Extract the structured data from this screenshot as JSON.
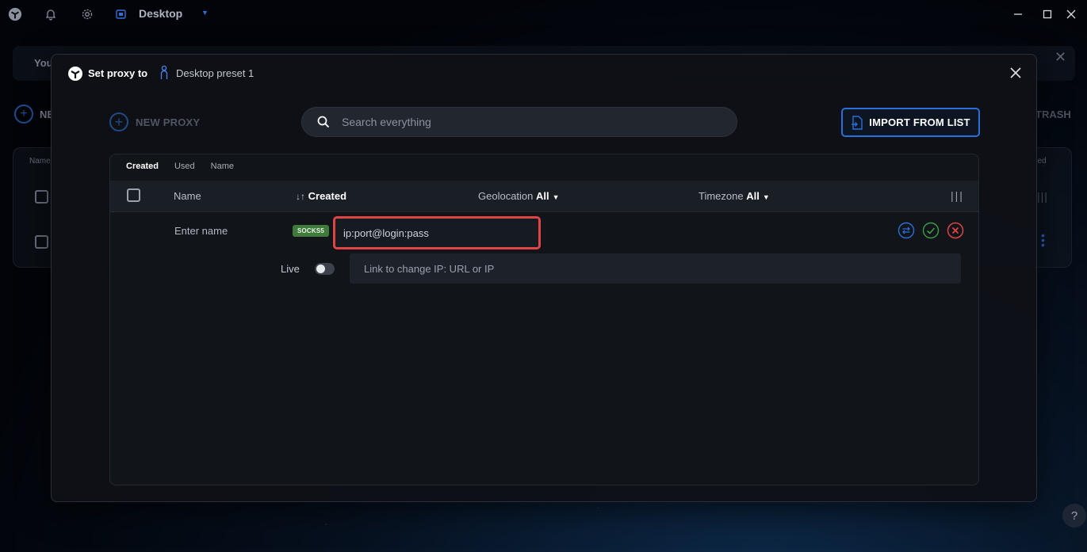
{
  "app": {
    "title": "Desktop"
  },
  "background": {
    "banner_text": "You",
    "new_text": "NE",
    "trash_text": "TRASH",
    "col_name": "Name",
    "col_right": "ned"
  },
  "modal": {
    "title": "Set proxy to",
    "preset": "Desktop preset 1",
    "new_proxy_label": "NEW PROXY",
    "search_placeholder": "Search everything",
    "import_label": "IMPORT FROM LIST",
    "sort_tabs": [
      "Created",
      "Used",
      "Name"
    ],
    "table": {
      "headers": {
        "name": "Name",
        "created": "Created",
        "geolocation": "Geolocation",
        "geolocation_value": "All",
        "timezone": "Timezone",
        "timezone_value": "All"
      }
    },
    "row": {
      "name_placeholder": "Enter name",
      "protocol": "SOCKS5",
      "proxy_placeholder": "ip:port@login:pass",
      "live_label": "Live",
      "live_on": false,
      "link_placeholder": "Link to change IP: URL or IP"
    }
  },
  "colors": {
    "accent": "#2a6fd8",
    "error": "#e04444",
    "success": "#3f7a3a"
  },
  "icons": [
    "app-logo-icon",
    "bell-icon",
    "gear-icon",
    "desktop-icon",
    "search-icon",
    "file-import-icon",
    "rotate-icon",
    "check-icon",
    "close-icon",
    "person-icon",
    "help-icon"
  ]
}
